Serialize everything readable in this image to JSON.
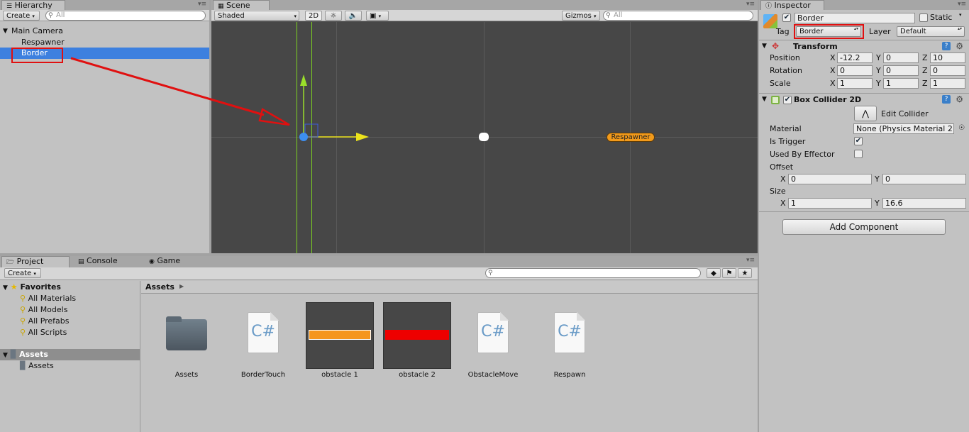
{
  "hierarchy": {
    "tab": "Hierarchy",
    "create": "Create",
    "search_placeholder": "All",
    "root": "Main Camera",
    "items": [
      "Respawner",
      "Border"
    ]
  },
  "scene": {
    "tab": "Scene",
    "shading": "Shaded",
    "mode_2d": "2D",
    "gizmos": "Gizmos",
    "search_placeholder": "All",
    "object_label": "Respawner"
  },
  "inspector": {
    "tab": "Inspector",
    "object_name": "Border",
    "static_label": "Static",
    "tag_label": "Tag",
    "tag_value": "Border",
    "layer_label": "Layer",
    "layer_value": "Default",
    "transform": {
      "title": "Transform",
      "position_label": "Position",
      "rotation_label": "Rotation",
      "scale_label": "Scale",
      "position": {
        "x": "-12.2",
        "y": "0",
        "z": "10"
      },
      "rotation": {
        "x": "0",
        "y": "0",
        "z": "0"
      },
      "scale": {
        "x": "1",
        "y": "1",
        "z": "1"
      }
    },
    "box_collider": {
      "title": "Box Collider 2D",
      "edit_collider": "Edit Collider",
      "material_label": "Material",
      "material_value": "None (Physics Material 2",
      "is_trigger_label": "Is Trigger",
      "is_trigger": true,
      "used_by_effector_label": "Used By Effector",
      "used_by_effector": false,
      "offset_label": "Offset",
      "offset": {
        "x": "0",
        "y": "0"
      },
      "size_label": "Size",
      "size": {
        "x": "1",
        "y": "16.6"
      }
    },
    "add_component": "Add Component",
    "axis": {
      "x": "X",
      "y": "Y",
      "z": "Z"
    }
  },
  "project": {
    "tabs": [
      "Project",
      "Console",
      "Game"
    ],
    "create": "Create",
    "favorites_label": "Favorites",
    "favorites": [
      "All Materials",
      "All Models",
      "All Prefabs",
      "All Scripts"
    ],
    "assets_root": "Assets",
    "assets_child": "Assets",
    "breadcrumb": "Assets",
    "assets": [
      {
        "name": "Assets",
        "kind": "folder"
      },
      {
        "name": "BorderTouch",
        "kind": "script"
      },
      {
        "name": "obstacle 1",
        "kind": "sprite",
        "color": "#f5961e"
      },
      {
        "name": "obstacle 2",
        "kind": "sprite",
        "color": "#ee0000"
      },
      {
        "name": "ObstacleMove",
        "kind": "script"
      },
      {
        "name": "Respawn",
        "kind": "script"
      }
    ]
  },
  "colors": {
    "selection": "#3d80df",
    "highlight_box": "#e01010",
    "gizmo_green": "#9adf2a",
    "gizmo_yellow": "#ece31c",
    "respawner_badge": "#f29a1a"
  }
}
